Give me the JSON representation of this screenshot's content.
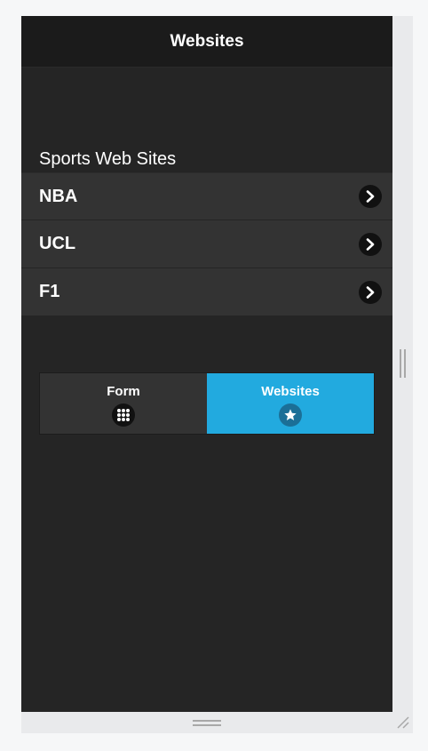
{
  "header": {
    "title": "Websites"
  },
  "content": {
    "section_title": "Sports Web Sites",
    "items": [
      {
        "label": "NBA",
        "icon": "chevron-right-icon"
      },
      {
        "label": "UCL",
        "icon": "chevron-right-icon"
      },
      {
        "label": "F1",
        "icon": "chevron-right-icon"
      }
    ]
  },
  "navbar": {
    "buttons": [
      {
        "label": "Form",
        "icon": "grid-icon",
        "active": false
      },
      {
        "label": "Websites",
        "icon": "star-icon",
        "active": true
      }
    ]
  },
  "colors": {
    "background": "#252525",
    "header": "#1b1b1b",
    "list_item": "#333333",
    "active_tab": "#22aadf"
  }
}
